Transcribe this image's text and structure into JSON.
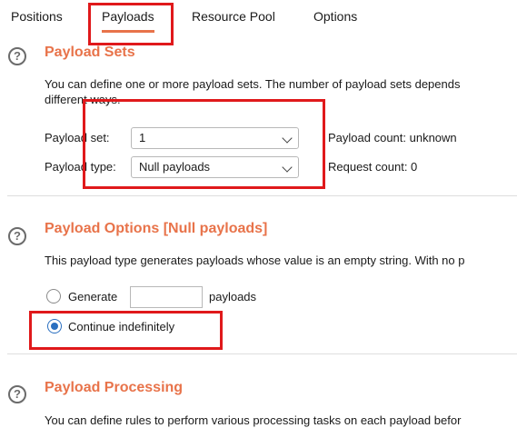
{
  "tabs": [
    {
      "label": "Positions"
    },
    {
      "label": "Payloads"
    },
    {
      "label": "Resource Pool"
    },
    {
      "label": "Options"
    }
  ],
  "payload_sets": {
    "title": "Payload Sets",
    "desc_line1": "You can define one or more payload sets. The number of payload sets depends",
    "desc_line2": "different ways.",
    "payload_set_label": "Payload set:",
    "payload_set_value": "1",
    "payload_type_label": "Payload type:",
    "payload_type_value": "Null payloads",
    "payload_count": "Payload count: unknown",
    "request_count": "Request count: 0"
  },
  "payload_options": {
    "title": "Payload Options [Null payloads]",
    "desc": "This payload type generates payloads whose value is an empty string. With no p",
    "generate_label": "Generate",
    "payloads_suffix": "payloads",
    "continue_label": "Continue indefinitely"
  },
  "payload_processing": {
    "title": "Payload Processing",
    "desc": "You can define rules to perform various processing tasks on each payload befor"
  },
  "colors": {
    "accent": "#e8734a",
    "annotation": "#e0191b",
    "radio_selected": "#2a6fc0"
  },
  "icons": {
    "help": "?"
  }
}
